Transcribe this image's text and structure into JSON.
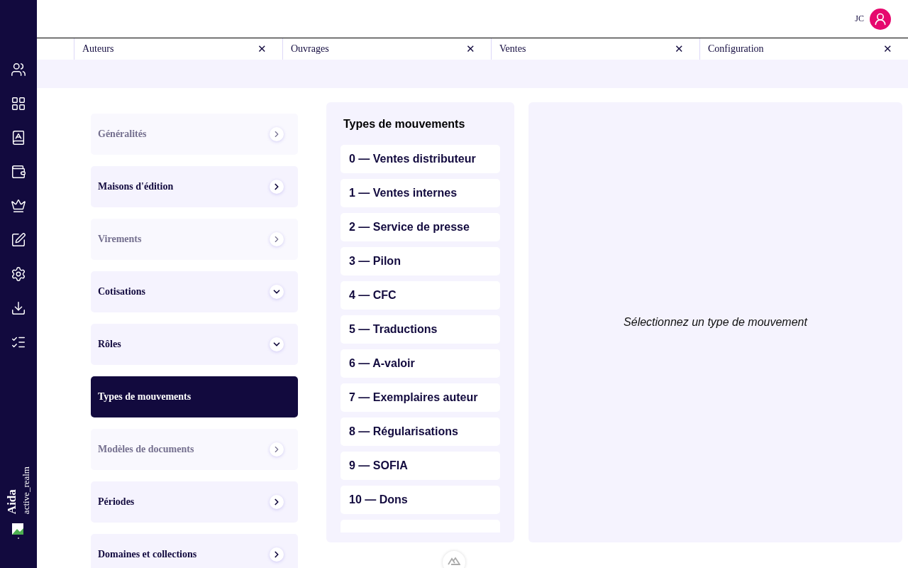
{
  "user": {
    "initials": "JC"
  },
  "tabs": [
    {
      "label": "Auteurs",
      "close": "✕"
    },
    {
      "label": "Ouvrages",
      "close": "✕"
    },
    {
      "label": "Ventes",
      "close": "✕"
    },
    {
      "label": "Configuration",
      "close": "✕"
    }
  ],
  "sidebar": {
    "app_name": "Aida",
    "realm": "active_realm"
  },
  "menu": [
    {
      "label": "Généralités",
      "disabled": true,
      "expanded": false,
      "selected": false
    },
    {
      "label": "Maisons d'édition",
      "disabled": false,
      "expanded": false,
      "selected": false
    },
    {
      "label": "Virements",
      "disabled": true,
      "expanded": false,
      "selected": false
    },
    {
      "label": "Cotisations",
      "disabled": false,
      "expanded": true,
      "selected": false
    },
    {
      "label": "Rôles",
      "disabled": false,
      "expanded": true,
      "selected": false
    },
    {
      "label": "Types de mouvements",
      "disabled": false,
      "selected": true
    },
    {
      "label": "Modèles de documents",
      "disabled": true,
      "expanded": false,
      "selected": false
    },
    {
      "label": "Périodes",
      "disabled": false,
      "expanded": false,
      "selected": false
    },
    {
      "label": "Domaines et collections",
      "disabled": false,
      "expanded": false,
      "selected": false
    }
  ],
  "movement_types": {
    "title": "Types de mouvements",
    "items": [
      "0 — Ventes distributeur",
      "1 — Ventes internes",
      "2 — Service de presse",
      "3 — Pilon",
      "4 — CFC",
      "5 — Traductions",
      "6 — A-valoir",
      "7 — Exemplaires auteur",
      "8 — Régularisations",
      "9 — SOFIA",
      "10 — Dons"
    ]
  },
  "detail": {
    "placeholder_text": "Sélectionnez un type de mouvement"
  }
}
